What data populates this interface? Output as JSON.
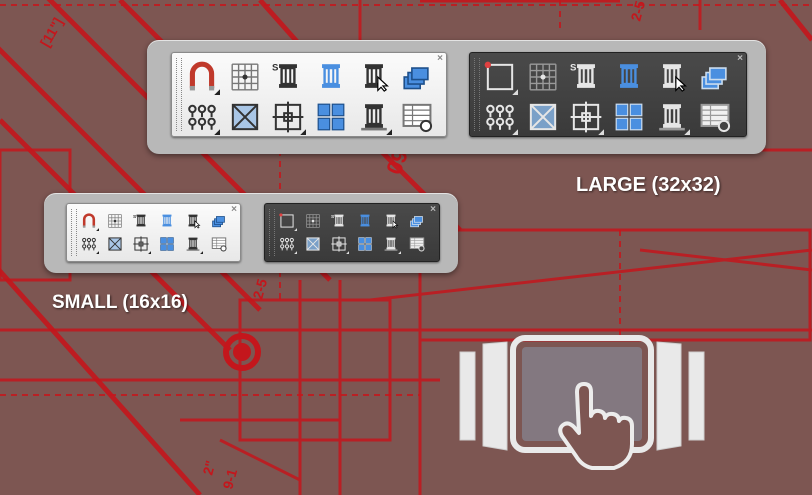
{
  "labels": {
    "large": "LARGE (32x32)",
    "small": "SMALL (16x16)"
  },
  "blueprint_text": {
    "dim_a": "[11\"]",
    "dim_b": "2-5",
    "dim_c": "09",
    "dim_d": "2-5",
    "dim_e": "2\"",
    "dim_f": "9-1"
  },
  "colors": {
    "background": "#7d5652",
    "blueprint_line": "#c4161c",
    "panel": "#b8b8b8",
    "toolbar_light": "#f2f2f2",
    "toolbar_dark": "#404040",
    "accent_blue": "#4a8fe0"
  },
  "toolbars": {
    "icons_row1": [
      "magnet-icon",
      "grid-snap-icon",
      "s-column-icon",
      "blue-column-icon",
      "column-select-icon",
      "stacked-layers-icon"
    ],
    "icons_row2": [
      "column-group-icon",
      "cross-box-icon",
      "grid-target-icon",
      "four-squares-icon",
      "column-base-icon",
      "schedule-table-icon"
    ]
  },
  "gesture": {
    "icon": "swipe-tablet-gesture-icon"
  }
}
